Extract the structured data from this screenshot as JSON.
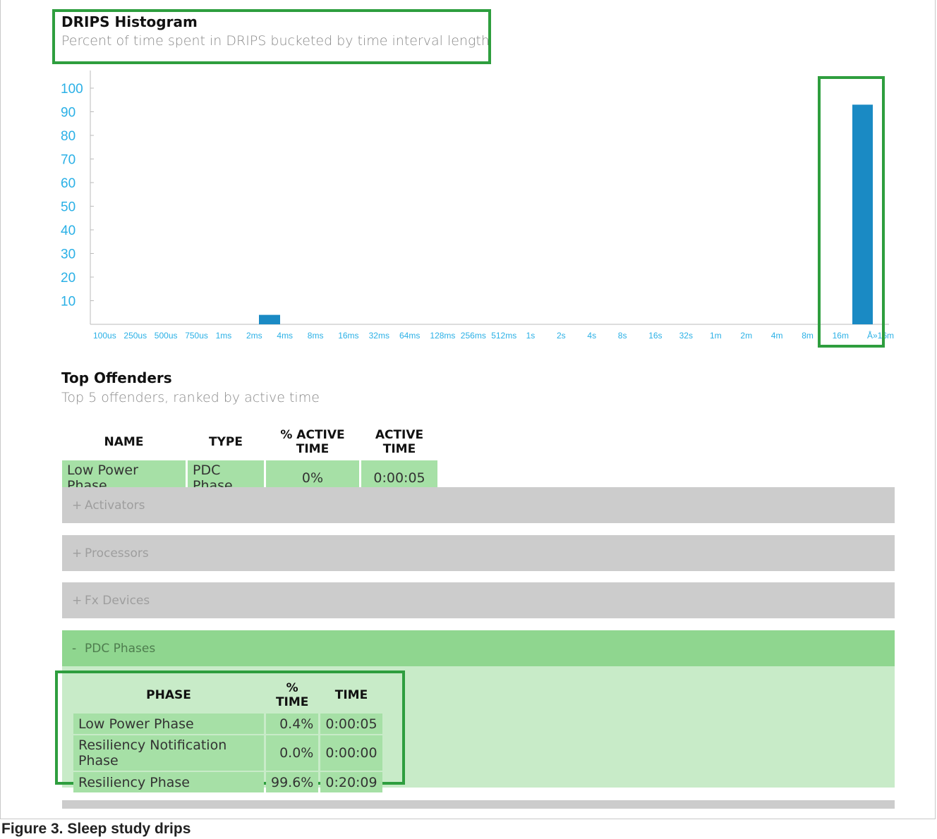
{
  "histogram": {
    "title": "DRIPS Histogram",
    "subtitle": "Percent of time spent in DRIPS bucketed by time interval length"
  },
  "chart_data": {
    "type": "bar",
    "categories": [
      "100us",
      "250us",
      "500us",
      "750us",
      "1ms",
      "2ms",
      "4ms",
      "8ms",
      "16ms",
      "32ms",
      "64ms",
      "128ms",
      "256ms",
      "512ms",
      "1s",
      "2s",
      "4s",
      "8s",
      "16s",
      "32s",
      "1m",
      "2m",
      "4m",
      "8m",
      "16m",
      "Å»16m"
    ],
    "values": [
      0,
      0,
      0,
      0,
      0,
      4,
      0,
      0,
      0,
      0,
      0,
      0,
      0,
      0,
      0,
      0,
      0,
      0,
      0,
      0,
      0,
      0,
      0,
      0,
      0,
      93
    ],
    "yticks": [
      10,
      20,
      30,
      40,
      50,
      60,
      70,
      80,
      90,
      100
    ],
    "ylim": [
      0,
      100
    ],
    "colors": {
      "bar": "#1a8ac4",
      "tick": "#2ab0e6",
      "axis": "#bbbbbb"
    }
  },
  "offenders": {
    "title": "Top Offenders",
    "subtitle": "Top 5 offenders, ranked by active time",
    "headers": [
      "NAME",
      "TYPE",
      "% ACTIVE TIME",
      "ACTIVE TIME"
    ],
    "rows": [
      [
        "Low Power Phase",
        "PDC Phase",
        "0%",
        "0:00:05"
      ]
    ]
  },
  "sections": [
    {
      "sign": "+",
      "label": "Activators"
    },
    {
      "sign": "+",
      "label": "Processors"
    },
    {
      "sign": "+",
      "label": "Fx Devices"
    },
    {
      "sign": "-",
      "label": "PDC Phases"
    }
  ],
  "pdc": {
    "headers": [
      "PHASE",
      "% TIME",
      "TIME"
    ],
    "rows": [
      [
        "Low Power Phase",
        "0.4%",
        "0:00:05"
      ],
      [
        "Resiliency Notification Phase",
        "0.0%",
        "0:00:00"
      ],
      [
        "Resiliency Phase",
        "99.6%",
        "0:20:09"
      ]
    ]
  },
  "caption": "Figure 3.  Sleep study drips",
  "colors": {
    "highlight": "#2e9e3e",
    "table_cell": "#a6e0a6",
    "section_gray": "#cccccc",
    "section_open": "#8fd68f"
  }
}
